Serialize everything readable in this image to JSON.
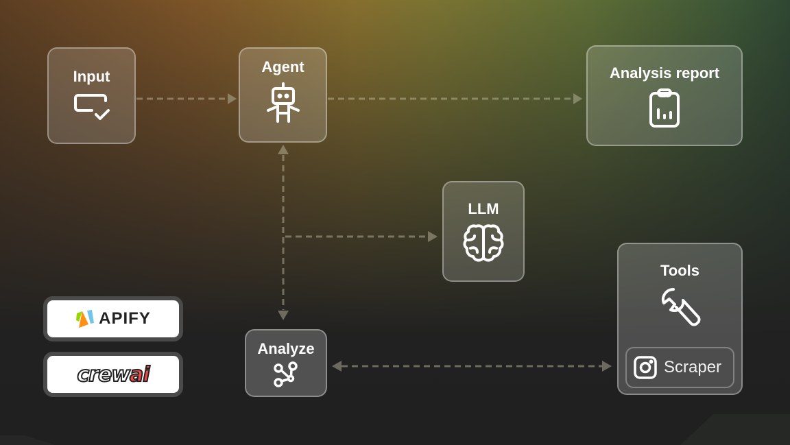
{
  "nodes": {
    "input": {
      "title": "Input",
      "icon": "input-check-icon"
    },
    "agent": {
      "title": "Agent",
      "icon": "robot-icon"
    },
    "report": {
      "title": "Analysis report",
      "icon": "clipboard-chart-icon"
    },
    "llm": {
      "title": "LLM",
      "icon": "brain-icon"
    },
    "analyze": {
      "title": "Analyze",
      "icon": "share-graph-icon"
    },
    "tools": {
      "title": "Tools",
      "icon": "wrench-icon",
      "sub_item": {
        "label": "Scraper",
        "icon": "instagram-icon"
      }
    }
  },
  "connections": [
    {
      "from": "Input",
      "to": "Agent",
      "style": "dashed",
      "direction": "forward"
    },
    {
      "from": "Agent",
      "to": "Analysis report",
      "style": "dashed",
      "direction": "forward"
    },
    {
      "from": "Agent",
      "to": "Analyze",
      "style": "dashed",
      "direction": "both"
    },
    {
      "from": "Agent-Analyze link",
      "to": "LLM",
      "style": "dashed",
      "direction": "forward"
    },
    {
      "from": "Analyze",
      "to": "Tools",
      "style": "dashed",
      "direction": "both"
    }
  ],
  "logos": {
    "apify": {
      "text": "APIFY",
      "colors": [
        "#97d700",
        "#ff9013",
        "#71c5e8"
      ]
    },
    "crewai": {
      "text_main": "crew",
      "text_accent": "ai",
      "accent_color": "#f04a46"
    }
  },
  "colors": {
    "connector": "#8f8a72",
    "node_border": "#c9c6b8"
  }
}
